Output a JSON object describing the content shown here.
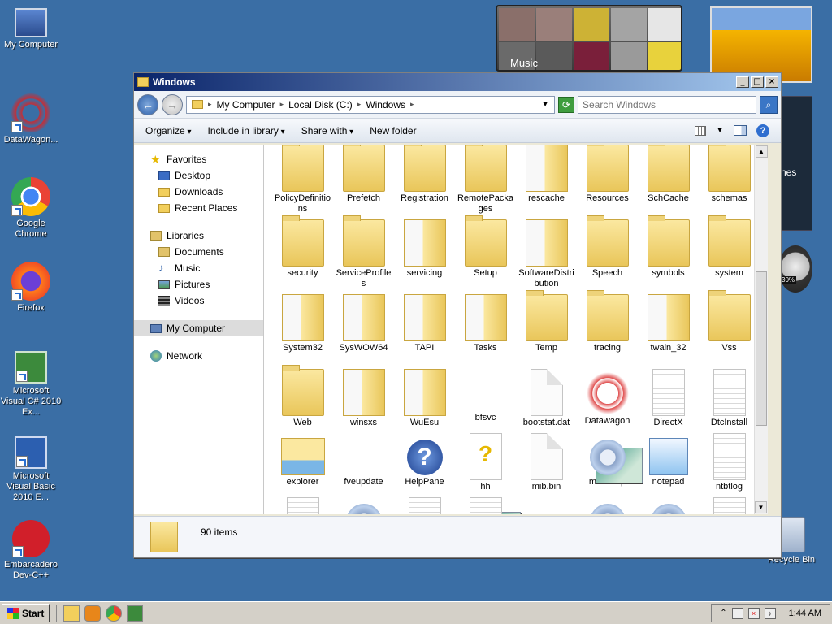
{
  "desktop": {
    "icons": [
      {
        "label": "My Computer"
      },
      {
        "label": "DataWagon..."
      },
      {
        "label": "Google Chrome"
      },
      {
        "label": "Firefox"
      },
      {
        "label": "Microsoft Visual C# 2010 Ex..."
      },
      {
        "label": "Microsoft Visual Basic 2010 E..."
      },
      {
        "label": "Embarcadero Dev-C++"
      }
    ],
    "recycle_bin": "Recycle Bin",
    "gadgets": {
      "music_label": "Music",
      "partial_text": "nes",
      "meter_value": "30%"
    }
  },
  "window": {
    "title": "Windows",
    "address": {
      "segments": [
        "My Computer",
        "Local Disk (C:)",
        "Windows"
      ]
    },
    "search": {
      "placeholder": "Search Windows"
    },
    "commands": {
      "organize": "Organize",
      "include": "Include in library",
      "share": "Share with",
      "new_folder": "New folder"
    },
    "nav": {
      "favorites": "Favorites",
      "fav_items": [
        "Desktop",
        "Downloads",
        "Recent Places"
      ],
      "libraries": "Libraries",
      "lib_items": [
        "Documents",
        "Music",
        "Pictures",
        "Videos"
      ],
      "computer": "My Computer",
      "network": "Network"
    },
    "files": [
      {
        "name": "PolicyDefinitions",
        "kind": "folder"
      },
      {
        "name": "Prefetch",
        "kind": "folder"
      },
      {
        "name": "Registration",
        "kind": "folder"
      },
      {
        "name": "RemotePackages",
        "kind": "folder"
      },
      {
        "name": "rescache",
        "kind": "folder-doc"
      },
      {
        "name": "Resources",
        "kind": "folder"
      },
      {
        "name": "SchCache",
        "kind": "folder"
      },
      {
        "name": "schemas",
        "kind": "folder"
      },
      {
        "name": "security",
        "kind": "folder"
      },
      {
        "name": "ServiceProfiles",
        "kind": "folder"
      },
      {
        "name": "servicing",
        "kind": "folder-doc"
      },
      {
        "name": "Setup",
        "kind": "folder"
      },
      {
        "name": "SoftwareDistribution",
        "kind": "folder-doc"
      },
      {
        "name": "Speech",
        "kind": "folder"
      },
      {
        "name": "symbols",
        "kind": "folder"
      },
      {
        "name": "system",
        "kind": "folder"
      },
      {
        "name": "System32",
        "kind": "folder-doc"
      },
      {
        "name": "SysWOW64",
        "kind": "folder-doc"
      },
      {
        "name": "TAPI",
        "kind": "folder-doc"
      },
      {
        "name": "Tasks",
        "kind": "folder-doc"
      },
      {
        "name": "Temp",
        "kind": "folder"
      },
      {
        "name": "tracing",
        "kind": "folder"
      },
      {
        "name": "twain_32",
        "kind": "folder-doc"
      },
      {
        "name": "Vss",
        "kind": "folder"
      },
      {
        "name": "Web",
        "kind": "folder"
      },
      {
        "name": "winsxs",
        "kind": "folder-doc"
      },
      {
        "name": "WuEsu",
        "kind": "folder-doc"
      },
      {
        "name": "bfsvc",
        "kind": "window"
      },
      {
        "name": "bootstat.dat",
        "kind": "doc"
      },
      {
        "name": "Datawagon",
        "kind": "star"
      },
      {
        "name": "DirectX",
        "kind": "doclines"
      },
      {
        "name": "DtcInstall",
        "kind": "doclines"
      },
      {
        "name": "explorer",
        "kind": "explorer"
      },
      {
        "name": "fveupdate",
        "kind": "window"
      },
      {
        "name": "HelpPane",
        "kind": "help"
      },
      {
        "name": "hh",
        "kind": "hh"
      },
      {
        "name": "mib.bin",
        "kind": "doc"
      },
      {
        "name": "msdfmap",
        "kind": "gear"
      },
      {
        "name": "notepad",
        "kind": "notepad"
      },
      {
        "name": "ntbtlog",
        "kind": "doclines"
      },
      {
        "name": "",
        "kind": "doclines"
      },
      {
        "name": "",
        "kind": "gear"
      },
      {
        "name": "",
        "kind": "doclines"
      },
      {
        "name": "",
        "kind": "doclines"
      },
      {
        "name": "",
        "kind": "window"
      },
      {
        "name": "",
        "kind": "gear"
      },
      {
        "name": "",
        "kind": "gear"
      },
      {
        "name": "",
        "kind": "doclines"
      }
    ],
    "status": {
      "count": "90 items"
    }
  },
  "taskbar": {
    "start": "Start",
    "clock": "1:44 AM"
  }
}
